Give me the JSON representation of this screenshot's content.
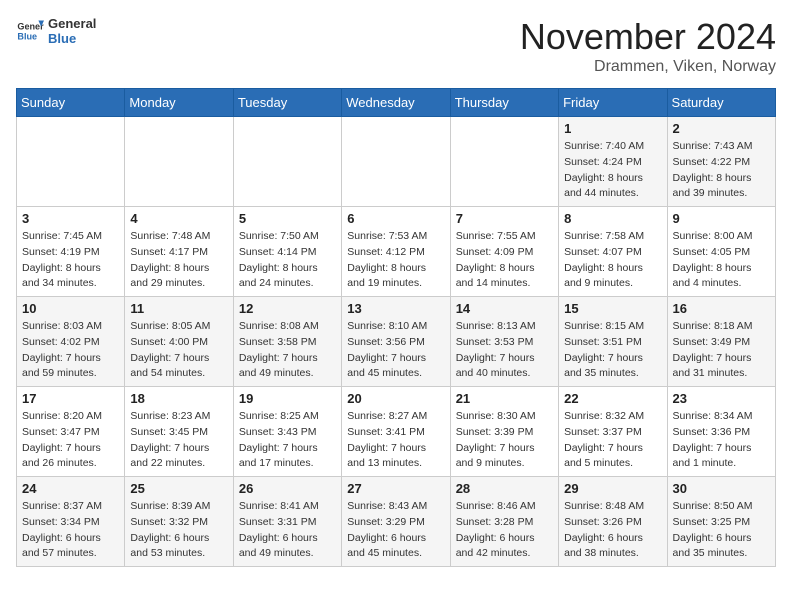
{
  "logo": {
    "general": "General",
    "blue": "Blue"
  },
  "title": "November 2024",
  "location": "Drammen, Viken, Norway",
  "days_of_week": [
    "Sunday",
    "Monday",
    "Tuesday",
    "Wednesday",
    "Thursday",
    "Friday",
    "Saturday"
  ],
  "weeks": [
    [
      {
        "day": "",
        "info": ""
      },
      {
        "day": "",
        "info": ""
      },
      {
        "day": "",
        "info": ""
      },
      {
        "day": "",
        "info": ""
      },
      {
        "day": "",
        "info": ""
      },
      {
        "day": "1",
        "info": "Sunrise: 7:40 AM\nSunset: 4:24 PM\nDaylight: 8 hours\nand 44 minutes."
      },
      {
        "day": "2",
        "info": "Sunrise: 7:43 AM\nSunset: 4:22 PM\nDaylight: 8 hours\nand 39 minutes."
      }
    ],
    [
      {
        "day": "3",
        "info": "Sunrise: 7:45 AM\nSunset: 4:19 PM\nDaylight: 8 hours\nand 34 minutes."
      },
      {
        "day": "4",
        "info": "Sunrise: 7:48 AM\nSunset: 4:17 PM\nDaylight: 8 hours\nand 29 minutes."
      },
      {
        "day": "5",
        "info": "Sunrise: 7:50 AM\nSunset: 4:14 PM\nDaylight: 8 hours\nand 24 minutes."
      },
      {
        "day": "6",
        "info": "Sunrise: 7:53 AM\nSunset: 4:12 PM\nDaylight: 8 hours\nand 19 minutes."
      },
      {
        "day": "7",
        "info": "Sunrise: 7:55 AM\nSunset: 4:09 PM\nDaylight: 8 hours\nand 14 minutes."
      },
      {
        "day": "8",
        "info": "Sunrise: 7:58 AM\nSunset: 4:07 PM\nDaylight: 8 hours\nand 9 minutes."
      },
      {
        "day": "9",
        "info": "Sunrise: 8:00 AM\nSunset: 4:05 PM\nDaylight: 8 hours\nand 4 minutes."
      }
    ],
    [
      {
        "day": "10",
        "info": "Sunrise: 8:03 AM\nSunset: 4:02 PM\nDaylight: 7 hours\nand 59 minutes."
      },
      {
        "day": "11",
        "info": "Sunrise: 8:05 AM\nSunset: 4:00 PM\nDaylight: 7 hours\nand 54 minutes."
      },
      {
        "day": "12",
        "info": "Sunrise: 8:08 AM\nSunset: 3:58 PM\nDaylight: 7 hours\nand 49 minutes."
      },
      {
        "day": "13",
        "info": "Sunrise: 8:10 AM\nSunset: 3:56 PM\nDaylight: 7 hours\nand 45 minutes."
      },
      {
        "day": "14",
        "info": "Sunrise: 8:13 AM\nSunset: 3:53 PM\nDaylight: 7 hours\nand 40 minutes."
      },
      {
        "day": "15",
        "info": "Sunrise: 8:15 AM\nSunset: 3:51 PM\nDaylight: 7 hours\nand 35 minutes."
      },
      {
        "day": "16",
        "info": "Sunrise: 8:18 AM\nSunset: 3:49 PM\nDaylight: 7 hours\nand 31 minutes."
      }
    ],
    [
      {
        "day": "17",
        "info": "Sunrise: 8:20 AM\nSunset: 3:47 PM\nDaylight: 7 hours\nand 26 minutes."
      },
      {
        "day": "18",
        "info": "Sunrise: 8:23 AM\nSunset: 3:45 PM\nDaylight: 7 hours\nand 22 minutes."
      },
      {
        "day": "19",
        "info": "Sunrise: 8:25 AM\nSunset: 3:43 PM\nDaylight: 7 hours\nand 17 minutes."
      },
      {
        "day": "20",
        "info": "Sunrise: 8:27 AM\nSunset: 3:41 PM\nDaylight: 7 hours\nand 13 minutes."
      },
      {
        "day": "21",
        "info": "Sunrise: 8:30 AM\nSunset: 3:39 PM\nDaylight: 7 hours\nand 9 minutes."
      },
      {
        "day": "22",
        "info": "Sunrise: 8:32 AM\nSunset: 3:37 PM\nDaylight: 7 hours\nand 5 minutes."
      },
      {
        "day": "23",
        "info": "Sunrise: 8:34 AM\nSunset: 3:36 PM\nDaylight: 7 hours\nand 1 minute."
      }
    ],
    [
      {
        "day": "24",
        "info": "Sunrise: 8:37 AM\nSunset: 3:34 PM\nDaylight: 6 hours\nand 57 minutes."
      },
      {
        "day": "25",
        "info": "Sunrise: 8:39 AM\nSunset: 3:32 PM\nDaylight: 6 hours\nand 53 minutes."
      },
      {
        "day": "26",
        "info": "Sunrise: 8:41 AM\nSunset: 3:31 PM\nDaylight: 6 hours\nand 49 minutes."
      },
      {
        "day": "27",
        "info": "Sunrise: 8:43 AM\nSunset: 3:29 PM\nDaylight: 6 hours\nand 45 minutes."
      },
      {
        "day": "28",
        "info": "Sunrise: 8:46 AM\nSunset: 3:28 PM\nDaylight: 6 hours\nand 42 minutes."
      },
      {
        "day": "29",
        "info": "Sunrise: 8:48 AM\nSunset: 3:26 PM\nDaylight: 6 hours\nand 38 minutes."
      },
      {
        "day": "30",
        "info": "Sunrise: 8:50 AM\nSunset: 3:25 PM\nDaylight: 6 hours\nand 35 minutes."
      }
    ]
  ]
}
